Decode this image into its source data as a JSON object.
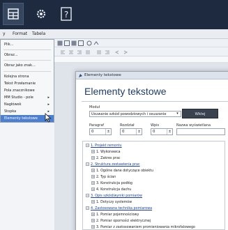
{
  "ribbon": {
    "buttons": [
      {
        "name": "table-icon",
        "active": true
      },
      {
        "name": "gear-icon",
        "active": false
      },
      {
        "name": "help-icon",
        "active": false
      }
    ]
  },
  "menubar": {
    "items": [
      "y",
      "Format",
      "Tabela"
    ]
  },
  "dropdown": {
    "items": [
      {
        "label": "Plik...",
        "arrow": ""
      },
      {
        "label": "Obraz...",
        "arrow": ""
      },
      {
        "label": "Obraz jako znak...",
        "arrow": ""
      },
      {
        "label": "Kolejna strona",
        "arrow": ""
      },
      {
        "label": "Tekst Przełamanie",
        "arrow": ""
      },
      {
        "label": "Pola znacznikowe",
        "arrow": ""
      },
      {
        "label": "MM Studio - pole",
        "arrow": "▸"
      },
      {
        "label": "Nagłówek",
        "arrow": "▸"
      },
      {
        "label": "Stopka",
        "arrow": "▸"
      },
      {
        "label": "Elementy tekstowe",
        "arrow": ""
      }
    ],
    "highlighted": "Elementy tekstowe"
  },
  "dialog": {
    "title": "Elementy tekstowe",
    "heading": "Elementy tekstowe",
    "module_label": "Moduł",
    "module_value": "Usuwanie szkód powodziowych i osuszanie",
    "insert_button": "Wkłej",
    "fields": {
      "paragraf_label": "Paragraf",
      "paragraf_value": "0",
      "rozdzial_label": "Rozdział",
      "rozdzial_value": "0",
      "wpis_label": "Wpis",
      "wpis_value": "0",
      "nazwa_label": "Nazwa wyświetlana",
      "nazwa_value": ""
    },
    "tree": [
      {
        "level": 0,
        "toggle": "−",
        "text": "1. Projekt remontu"
      },
      {
        "level": 1,
        "toggle": "+",
        "text": "1. Wykonawca"
      },
      {
        "level": 1,
        "toggle": "+",
        "text": "2. Zakres prac"
      },
      {
        "level": 0,
        "toggle": "−",
        "text": "2. Struktura zestawienia prac"
      },
      {
        "level": 1,
        "toggle": "+",
        "text": "1. Ogólne dane dotyczące obiektu"
      },
      {
        "level": 1,
        "toggle": "+",
        "text": "2. Typ ścian"
      },
      {
        "level": 1,
        "toggle": "+",
        "text": "3. Konstrukcja podłóg"
      },
      {
        "level": 1,
        "toggle": "+",
        "text": "4. Konstrukcja dachu"
      },
      {
        "level": 0,
        "toggle": "−",
        "text": "3. Opis szkód/wyniki pomiarów"
      },
      {
        "level": 1,
        "toggle": "+",
        "text": "1. Dotyczy systemów"
      },
      {
        "level": 0,
        "toggle": "−",
        "text": "4. Zastosowana technika pomiarowa"
      },
      {
        "level": 1,
        "toggle": "+",
        "text": "1. Pomiar pojemnościowy"
      },
      {
        "level": 1,
        "toggle": "+",
        "text": "2. Pomiar oporności elektrycznej"
      },
      {
        "level": 1,
        "toggle": "+",
        "text": "3. Pomiar z zastosowaniem promieniowania mikrofalowego"
      }
    ]
  },
  "colors": {
    "ribbon": "#1e2a3f",
    "highlight": "#4c7fd0",
    "heading": "#1f3a5e",
    "insert_button": "#3a4250"
  }
}
